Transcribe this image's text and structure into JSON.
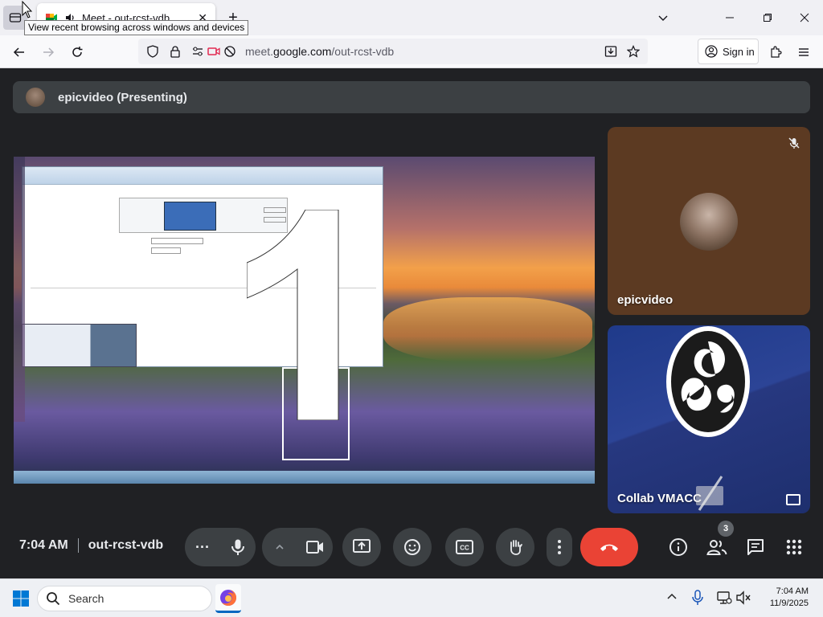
{
  "browser": {
    "tab_title": "Meet - out-rcst-vdb",
    "tooltip": "View recent browsing across windows and devices",
    "url_prefix": "meet.",
    "url_domain": "google.com",
    "url_path": "/out-rcst-vdb",
    "signin_label": "Sign in"
  },
  "meet": {
    "presenter_label": "epicvideo (Presenting)",
    "participants": [
      {
        "name": "epicvideo",
        "muted": true
      },
      {
        "name": "Collab VMACC",
        "muted": false
      }
    ],
    "time": "7:04 AM",
    "meeting_code": "out-rcst-vdb",
    "people_count": "3",
    "colors": {
      "end_call": "#ea4335",
      "control_bg": "#3c4043",
      "bg": "#202124"
    }
  },
  "taskbar": {
    "search_placeholder": "Search",
    "time": "7:04 AM",
    "date": "11/9/2025"
  }
}
